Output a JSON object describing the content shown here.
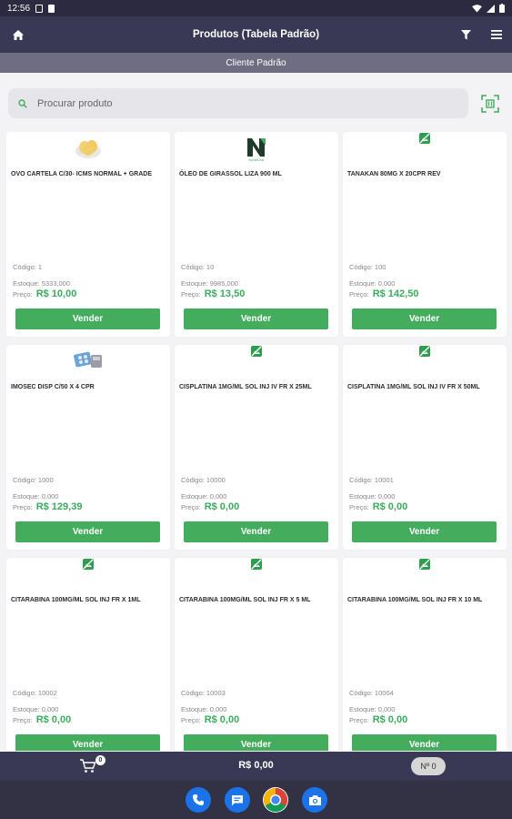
{
  "status": {
    "time": "12:56"
  },
  "appbar": {
    "title": "Produtos (Tabela Padrão)"
  },
  "subbar": {
    "client": "Cliente Padrão"
  },
  "search": {
    "placeholder": "Procurar produto"
  },
  "colors": {
    "accent": "#43ad5d",
    "header": "#3a3955",
    "price": "#3aad5c"
  },
  "products": [
    {
      "name": "OVO CARTELA C/30- ICMS NORMAL + GRADE",
      "code": "Código: 1",
      "stock": "Estoque: 5333,000",
      "price_label": "Preço:",
      "price": "R$ 10,00",
      "image": "eggs-image",
      "sell_label": "Vender"
    },
    {
      "name": "ÓLEO DE GIRASSOL LIZA 900 ML",
      "code": "Código: 10",
      "stock": "Estoque: 9985,000",
      "price_label": "Preço:",
      "price": "R$ 13,50",
      "image": "nortelink-logo",
      "sell_label": "Vender"
    },
    {
      "name": "TANAKAN 80MG X 20CPR REV",
      "code": "Código: 100",
      "stock": "Estoque: 0,000",
      "price_label": "Preço:",
      "price": "R$ 142,50",
      "image": "no-image-icon",
      "sell_label": "Vender"
    },
    {
      "name": "IMOSEC DISP C/50 X 4 CPR",
      "code": "Código: 1000",
      "stock": "Estoque: 0,000",
      "price_label": "Preço:",
      "price": "R$ 129,39",
      "image": "pills-image",
      "sell_label": "Vender"
    },
    {
      "name": "CISPLATINA 1MG/ML SOL INJ IV FR X 25ML",
      "code": "Código: 10000",
      "stock": "Estoque: 0,000",
      "price_label": "Preço:",
      "price": "R$ 0,00",
      "image": "no-image-icon",
      "sell_label": "Vender"
    },
    {
      "name": "CISPLATINA 1MG/ML SOL INJ IV FR X 50ML",
      "code": "Código: 10001",
      "stock": "Estoque: 0,000",
      "price_label": "Preço:",
      "price": "R$ 0,00",
      "image": "no-image-icon",
      "sell_label": "Vender"
    },
    {
      "name": "CITARABINA 100MG/ML SOL INJ FR X 1ML",
      "code": "Código: 10002",
      "stock": "Estoque: 0,000",
      "price_label": "Preço:",
      "price": "R$ 0,00",
      "image": "no-image-icon",
      "sell_label": "Vender"
    },
    {
      "name": "CITARABINA 100MG/ML SOL INJ FR X 5 ML",
      "code": "Código: 10003",
      "stock": "Estoque: 0,000",
      "price_label": "Preço:",
      "price": "R$ 0,00",
      "image": "no-image-icon",
      "sell_label": "Vender"
    },
    {
      "name": "CITARABINA 100MG/ML SOL INJ FR X 10 ML",
      "code": "Código: 10004",
      "stock": "Estoque: 0,000",
      "price_label": "Preço:",
      "price": "R$ 0,00",
      "image": "no-image-icon",
      "sell_label": "Vender"
    }
  ],
  "bottombar": {
    "cart_count": "0",
    "total": "R$ 0,00",
    "order_number": "Nº 0"
  }
}
